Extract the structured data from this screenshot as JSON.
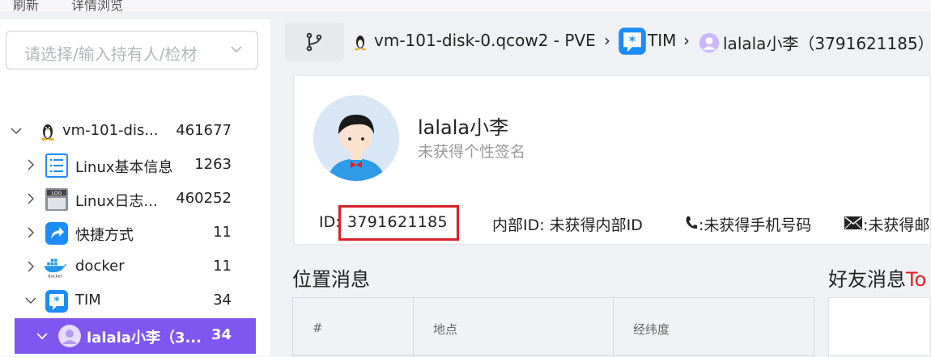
{
  "topbar": {
    "left_text": "刷新",
    "right_text": "详情浏览"
  },
  "sidebar": {
    "search_placeholder": "请选择/输入持有人/检材",
    "items": [
      {
        "label": "vm-101-dis...",
        "count": "461677",
        "expanded": true,
        "icon": "linux-penguin-icon"
      },
      {
        "label": "Linux基本信息",
        "count": "1263",
        "expanded": false,
        "icon": "list-doc-icon"
      },
      {
        "label": "Linux日志...",
        "count": "460252",
        "expanded": false,
        "icon": "log-icon"
      },
      {
        "label": "快捷方式",
        "count": "11",
        "expanded": false,
        "icon": "shortcut-icon"
      },
      {
        "label": "docker",
        "count": "11",
        "expanded": false,
        "icon": "docker-icon"
      },
      {
        "label": "TIM",
        "count": "34",
        "expanded": true,
        "icon": "tim-icon"
      },
      {
        "label": "lalala小李（3...",
        "count": "34",
        "expanded": true,
        "selected": true,
        "icon": "user-avatar-icon"
      }
    ]
  },
  "breadcrumb": {
    "items": [
      "vm-101-disk-0.qcow2 - PVE",
      "TIM",
      "lalala小李（3791621185）"
    ]
  },
  "profile": {
    "name": "lalala小李",
    "signature": "未获得个性签名",
    "id_label": "ID:",
    "id_value": "3791621185",
    "internal_id": "内部ID: 未获得内部ID",
    "phone": ":未获得手机号码",
    "email": ":未获得邮"
  },
  "location_section": {
    "title": "位置消息",
    "columns": [
      "#",
      "地点",
      "经纬度"
    ]
  },
  "friend_section": {
    "title": "好友消息",
    "suffix": "To"
  },
  "colors": {
    "accent": "#7f56ef",
    "highlight_box": "#d9202a",
    "tim_blue": "#1d8cf8"
  }
}
